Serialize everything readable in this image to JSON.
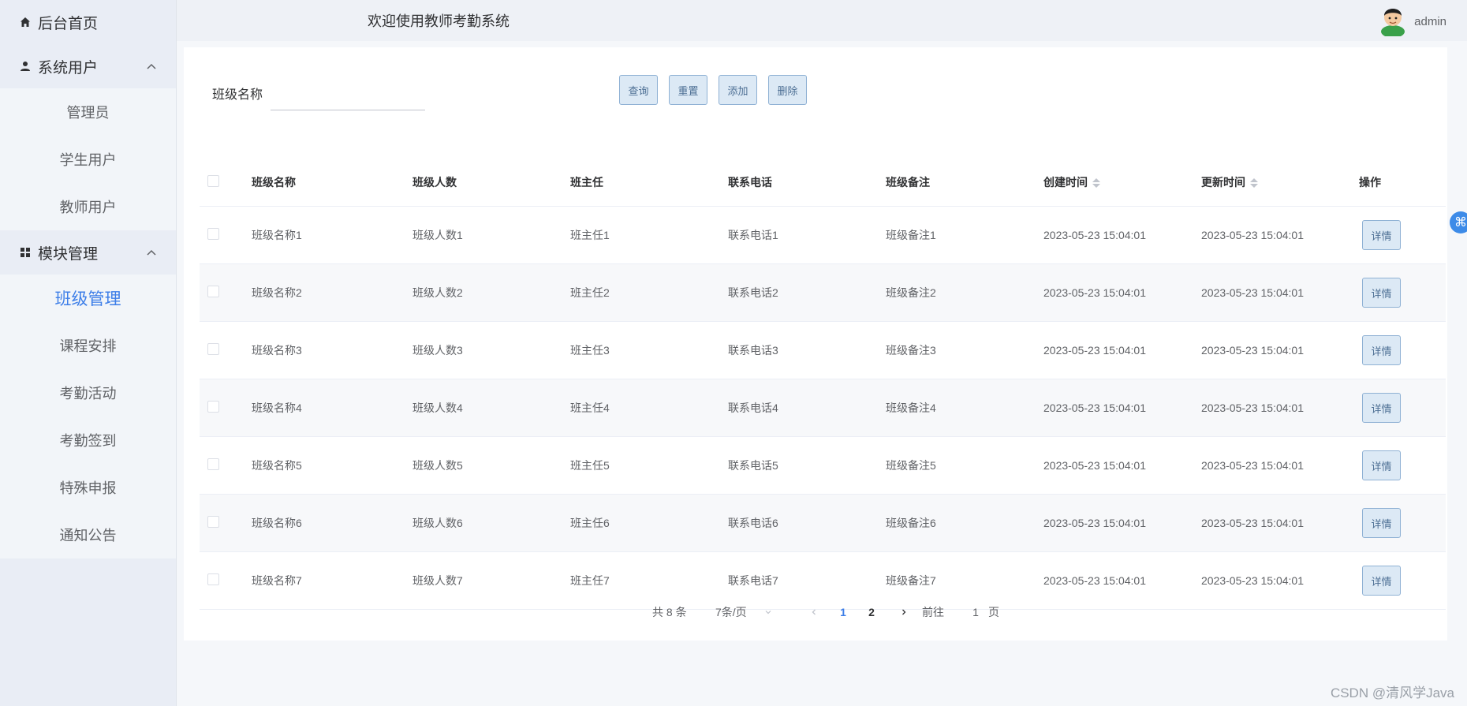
{
  "sidebar": {
    "home": "后台首页",
    "groups": [
      {
        "label": "系统用户",
        "items": [
          "管理员",
          "学生用户",
          "教师用户"
        ]
      },
      {
        "label": "模块管理",
        "items": [
          "班级管理",
          "课程安排",
          "考勤活动",
          "考勤签到",
          "特殊申报",
          "通知公告"
        ],
        "active": "班级管理"
      }
    ]
  },
  "header": {
    "title": "欢迎使用教师考勤系统",
    "username": "admin"
  },
  "search": {
    "label": "班级名称",
    "value": "",
    "placeholder": ""
  },
  "buttons": {
    "query": "查询",
    "reset": "重置",
    "add": "添加",
    "delete": "删除"
  },
  "table": {
    "columns": [
      "班级名称",
      "班级人数",
      "班主任",
      "联系电话",
      "班级备注",
      "创建时间",
      "更新时间",
      "操作"
    ],
    "rows": [
      [
        "班级名称1",
        "班级人数1",
        "班主任1",
        "联系电话1",
        "班级备注1",
        "2023-05-23 15:04:01",
        "2023-05-23 15:04:01",
        "详情"
      ],
      [
        "班级名称2",
        "班级人数2",
        "班主任2",
        "联系电话2",
        "班级备注2",
        "2023-05-23 15:04:01",
        "2023-05-23 15:04:01",
        "详情"
      ],
      [
        "班级名称3",
        "班级人数3",
        "班主任3",
        "联系电话3",
        "班级备注3",
        "2023-05-23 15:04:01",
        "2023-05-23 15:04:01",
        "详情"
      ],
      [
        "班级名称4",
        "班级人数4",
        "班主任4",
        "联系电话4",
        "班级备注4",
        "2023-05-23 15:04:01",
        "2023-05-23 15:04:01",
        "详情"
      ],
      [
        "班级名称5",
        "班级人数5",
        "班主任5",
        "联系电话5",
        "班级备注5",
        "2023-05-23 15:04:01",
        "2023-05-23 15:04:01",
        "详情"
      ],
      [
        "班级名称6",
        "班级人数6",
        "班主任6",
        "联系电话6",
        "班级备注6",
        "2023-05-23 15:04:01",
        "2023-05-23 15:04:01",
        "详情"
      ],
      [
        "班级名称7",
        "班级人数7",
        "班主任7",
        "联系电话7",
        "班级备注7",
        "2023-05-23 15:04:01",
        "2023-05-23 15:04:01",
        "详情"
      ]
    ]
  },
  "pagination": {
    "total": "共 8 条",
    "page_size": "7条/页",
    "pages": [
      "1",
      "2"
    ],
    "current": "1",
    "goto_prefix": "前往",
    "goto_value": "1",
    "goto_suffix": "页"
  },
  "watermark": "CSDN @清风学Java",
  "colors": {
    "accent": "#3d7ee8",
    "button_bg": "#dce9f5",
    "sidebar_bg": "#e9edf5"
  },
  "icons": {
    "home": "home-icon",
    "user": "user-icon",
    "grid": "grid-icon",
    "chevron": "chevron-up-icon"
  }
}
